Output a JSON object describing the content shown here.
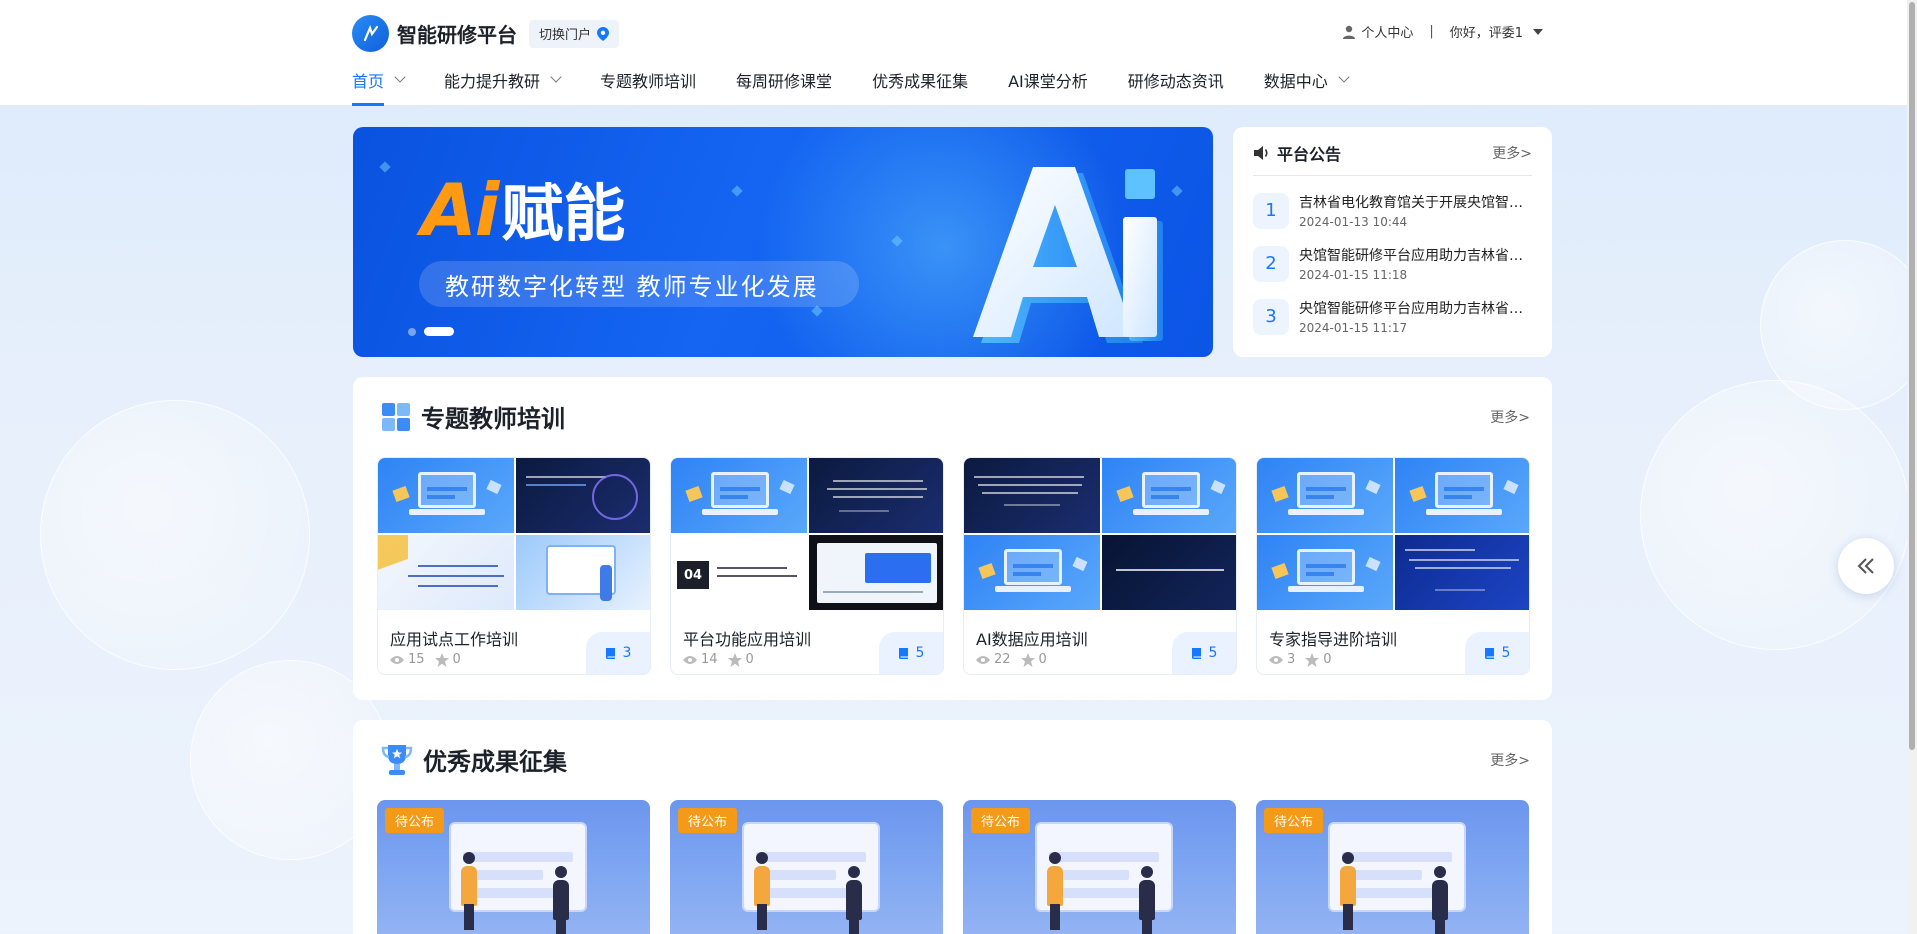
{
  "header": {
    "title": "智能研修平台",
    "switch_portal": "切换门户",
    "personal_center": "个人中心",
    "separator": "|",
    "greeting": "你好，评委1"
  },
  "nav": [
    {
      "label": "首页",
      "active": true,
      "dropdown": true
    },
    {
      "label": "能力提升教研",
      "active": false,
      "dropdown": true
    },
    {
      "label": "专题教师培训",
      "active": false,
      "dropdown": false
    },
    {
      "label": "每周研修课堂",
      "active": false,
      "dropdown": false
    },
    {
      "label": "优秀成果征集",
      "active": false,
      "dropdown": false
    },
    {
      "label": "AI课堂分析",
      "active": false,
      "dropdown": false
    },
    {
      "label": "研修动态资讯",
      "active": false,
      "dropdown": false
    },
    {
      "label": "数据中心",
      "active": false,
      "dropdown": true
    }
  ],
  "banner": {
    "ai_text": "Ai",
    "ai_cn": "赋能",
    "slogan": "教研数字化转型 教师专业化发展",
    "big_text": "Ai",
    "slides": 2,
    "active_slide": 2
  },
  "notice": {
    "title": "平台公告",
    "more": "更多>",
    "items": [
      {
        "num": "1",
        "title": "吉林省电化教育馆关于开展央馆智能研修平台应用工作的通知",
        "date": "2024-01-13 10:44"
      },
      {
        "num": "2",
        "title": "央馆智能研修平台应用助力吉林省教师专业发展",
        "date": "2024-01-15 11:18"
      },
      {
        "num": "3",
        "title": "央馆智能研修平台应用助力吉林省教育数字化转型",
        "date": "2024-01-15 11:17"
      }
    ]
  },
  "training": {
    "title": "专题教师培训",
    "more": "更多>",
    "cards": [
      {
        "name": "应用试点工作培训",
        "views": "15",
        "stars": "0",
        "count": "3"
      },
      {
        "name": "平台功能应用培训",
        "views": "14",
        "stars": "0",
        "count": "5"
      },
      {
        "name": "AI数据应用培训",
        "views": "22",
        "stars": "0",
        "count": "5"
      },
      {
        "name": "专家指导进阶培训",
        "views": "3",
        "stars": "0",
        "count": "5"
      }
    ]
  },
  "achievements": {
    "title": "优秀成果征集",
    "more": "更多>",
    "cards": [
      {
        "badge": "待公布"
      },
      {
        "badge": "待公布"
      },
      {
        "badge": "待公布"
      },
      {
        "badge": "待公布"
      }
    ]
  },
  "colors": {
    "accent": "#1677ff",
    "badge": "#f39a19",
    "ai_orange": "#ff9a12"
  }
}
